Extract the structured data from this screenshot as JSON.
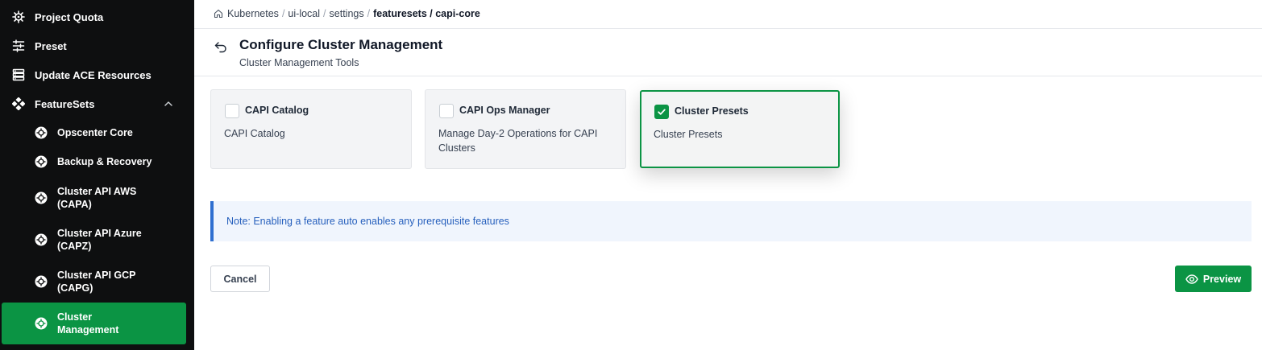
{
  "sidebar": {
    "items": [
      {
        "label": "Project Quota",
        "icon": "helm-icon"
      },
      {
        "label": "Preset",
        "icon": "sliders-icon"
      },
      {
        "label": "Update ACE Resources",
        "icon": "server-icon"
      },
      {
        "label": "FeatureSets",
        "icon": "featuresets-icon",
        "expanded": true
      }
    ],
    "subitems": [
      {
        "label": "Opscenter Core",
        "icon": "helm-icon"
      },
      {
        "label": "Backup & Recovery",
        "icon": "helm-icon"
      },
      {
        "label": "Cluster API AWS (CAPA)",
        "line1": "Cluster API AWS",
        "line2": "(CAPA)",
        "icon": "helm-icon"
      },
      {
        "label": "Cluster API Azure (CAPZ)",
        "line1": "Cluster API Azure",
        "line2": "(CAPZ)",
        "icon": "helm-icon"
      },
      {
        "label": "Cluster API GCP (CAPG)",
        "line1": "Cluster API GCP",
        "line2": "(CAPG)",
        "icon": "helm-icon"
      },
      {
        "label": "Cluster Management",
        "line1": "Cluster",
        "line2": "Management",
        "icon": "helm-icon",
        "active": true
      }
    ]
  },
  "breadcrumb": {
    "crumbs": [
      "Kubernetes",
      "ui-local",
      "settings",
      "featuresets / capi-core"
    ]
  },
  "page": {
    "title": "Configure Cluster Management",
    "subtitle": "Cluster Management Tools"
  },
  "features": [
    {
      "title": "CAPI Catalog",
      "description": "CAPI Catalog",
      "checked": false
    },
    {
      "title": "CAPI Ops Manager",
      "description": "Manage Day-2 Operations for CAPI Clusters",
      "checked": false
    },
    {
      "title": "Cluster Presets",
      "description": "Cluster Presets",
      "checked": true
    }
  ],
  "note": "Note: Enabling a feature auto enables any prerequisite features",
  "buttons": {
    "cancel": "Cancel",
    "preview": "Preview"
  },
  "colors": {
    "accent": "#0b9444",
    "sidebar_bg": "#0e0f10",
    "note_text": "#2760bd",
    "note_border": "#2f6fd0"
  }
}
